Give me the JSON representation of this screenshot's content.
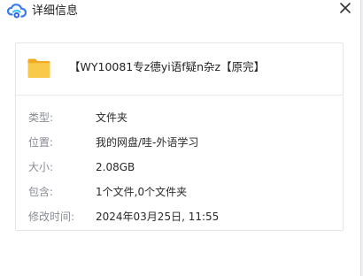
{
  "window": {
    "title": "详细信息",
    "close_icon": "close-icon",
    "logo_icon": "baidu-netdisk-logo-icon"
  },
  "file": {
    "name": "【WY10081专z德yi语f疑n杂z【原完】",
    "icon": "folder-icon",
    "icon_color": "#f6bf3c"
  },
  "details": {
    "rows": [
      {
        "label": "类型:",
        "value": "文件夹"
      },
      {
        "label": "位置:",
        "value": "我的网盘/哇-外语学习"
      },
      {
        "label": "大小:",
        "value": "2.08GB"
      },
      {
        "label": "包含:",
        "value": "1个文件,0个文件夹"
      },
      {
        "label": "修改时间:",
        "value": "2024年03月25日, 11:55"
      }
    ]
  },
  "colors": {
    "label_text": "#888c94",
    "value_text": "#2a2a2a",
    "card_border": "#e3e6eb",
    "logo_blue": "#3a7bf0"
  }
}
